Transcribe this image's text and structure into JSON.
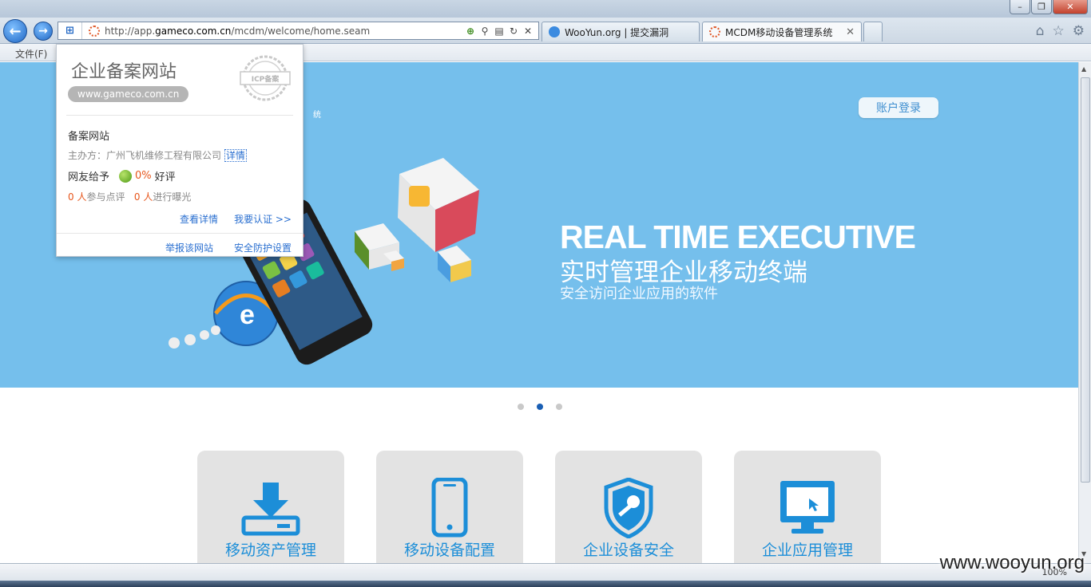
{
  "browser": {
    "url_prefix": "http://app.",
    "url_domain": "gameco.com.cn",
    "url_path": "/mcdm/welcome/home.seam",
    "tabs": [
      {
        "label": "WooYun.org | 提交漏洞"
      },
      {
        "label": "MCDM移动设备管理系统"
      }
    ],
    "menu_file": "文件(F)",
    "zoom": "100%"
  },
  "popup": {
    "title": "企业备案网站",
    "domain": "www.gameco.com.cn",
    "seal_text": "ICP备案",
    "section_head": "备案网站",
    "org_label": "主办方：广州飞机维修工程有限公司",
    "detail_link": "详情",
    "rating_prefix": "网友给予",
    "rating_value": "0%",
    "rating_suffix": "好评",
    "review_count": "0 人",
    "review_text": "参与点评",
    "expose_count": "0 人",
    "expose_text": "进行曝光",
    "link_view": "查看详情",
    "link_cert": "我要认证 >>",
    "link_report": "举报该网站",
    "link_security": "安全防护设置"
  },
  "page": {
    "login_button": "账户登录",
    "system_fragment": "统",
    "hero_title": "REAL TIME EXECUTIVE",
    "hero_subtitle": "实时管理企业移动终端",
    "hero_tagline": "安全访问企业应用的软件",
    "carousel": {
      "count": 3,
      "active_index": 1
    },
    "cards": [
      {
        "label": "移动资产管理",
        "icon": "download-tray-icon"
      },
      {
        "label": "移动设备配置",
        "icon": "smartphone-icon"
      },
      {
        "label": "企业设备安全",
        "icon": "shield-key-icon"
      },
      {
        "label": "企业应用管理",
        "icon": "monitor-touch-icon"
      }
    ]
  },
  "watermark": "www.wooyun.org",
  "colors": {
    "hero_bg": "#75bfec",
    "card_bg": "#e3e3e3",
    "accent_blue": "#1c8ed8",
    "link_blue": "#2a6fd0",
    "rating_orange": "#e7561c"
  }
}
